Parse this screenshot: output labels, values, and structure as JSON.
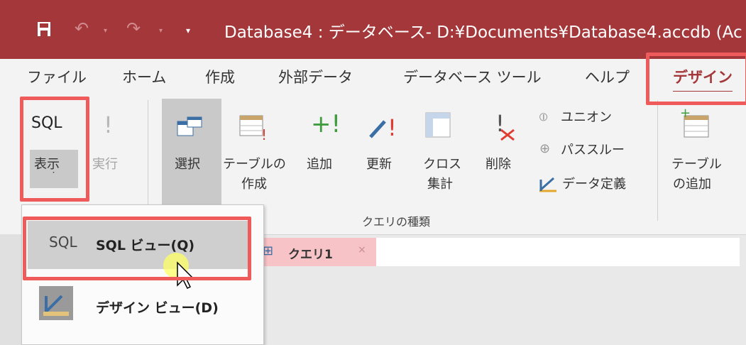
{
  "title_bar": {
    "save_icon": "save-icon",
    "title": "Database4 : データベース- D:¥Documents¥Database4.accdb (Ac"
  },
  "tabs": [
    "ファイル",
    "ホーム",
    "作成",
    "外部データ",
    "データベース ツール",
    "ヘルプ",
    "デザイン"
  ],
  "ribbon": {
    "view": {
      "label_top": "SQL",
      "label": "表示",
      "arrow": "˙"
    },
    "run": {
      "label": "実行"
    },
    "select": {
      "label": "選択"
    },
    "make_table": {
      "line1": "テーブルの",
      "line2": "作成"
    },
    "append": {
      "label": "追加"
    },
    "update": {
      "label": "更新"
    },
    "crosstab": {
      "line1": "クロス",
      "line2": "集計"
    },
    "delete": {
      "label": "削除"
    },
    "union": {
      "label": "ユニオン"
    },
    "passthrough": {
      "label": "パススルー"
    },
    "data_def": {
      "label": "データ定義"
    },
    "add_table": {
      "line1": "テーブル",
      "line2": "の追加"
    },
    "group_label": "クエリの種類"
  },
  "dropdown": {
    "items": [
      {
        "icon_text": "SQL",
        "label": "SQL ビュー(Q)"
      },
      {
        "icon": "design-view-icon",
        "label": "デザイン ビュー(D)"
      }
    ]
  },
  "document_tab": {
    "label": "クエリ1",
    "close": "×"
  },
  "colors": {
    "title_bg": "#a4373a",
    "highlight": "#ef5a5a",
    "active_tab": "#a4373a"
  }
}
